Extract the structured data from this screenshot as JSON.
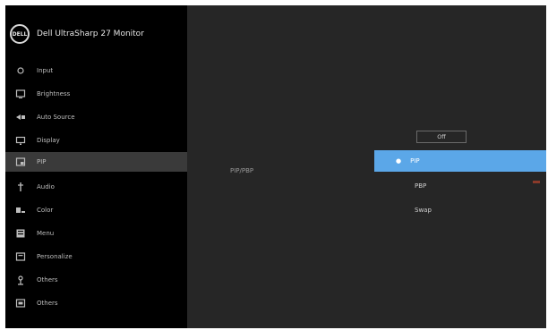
{
  "header": {
    "logo_text": "DELL",
    "title": "Dell UltraSharp 27 Monitor"
  },
  "sidebar": {
    "items": [
      {
        "label": "Input",
        "icon": "brightness-icon"
      },
      {
        "label": "Brightness",
        "icon": "brightness-contrast-icon"
      },
      {
        "label": "Auto Source",
        "icon": "auto-source-icon"
      },
      {
        "label": "Display",
        "icon": "display-icon"
      },
      {
        "label": "PIP",
        "icon": "pip-icon",
        "selected": true
      },
      {
        "label": "Audio",
        "icon": "audio-icon"
      },
      {
        "label": "Color",
        "icon": "color-icon"
      },
      {
        "label": "Menu",
        "icon": "menu-icon"
      },
      {
        "label": "Personalize",
        "icon": "personalize-icon"
      },
      {
        "label": "Others",
        "icon": "others-icon"
      }
    ]
  },
  "main": {
    "submenu_label": "PIP/PBP",
    "options": {
      "top_box": "Off",
      "selected": "PIP",
      "opt1": "PBP",
      "opt2": "Swap"
    }
  },
  "colors": {
    "accent": "#5ba7e8",
    "sidebar_bg": "#000000",
    "main_bg": "#262626"
  }
}
